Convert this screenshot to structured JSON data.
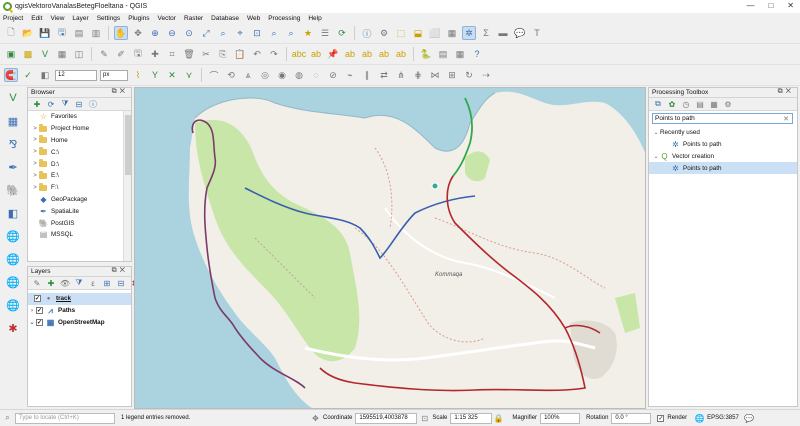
{
  "window": {
    "title": "qgisVektoroVanalasBetegFloeltana - QGIS",
    "buttons": [
      "—",
      "□",
      "✕"
    ]
  },
  "menu": [
    "Project",
    "Edit",
    "View",
    "Layer",
    "Settings",
    "Plugins",
    "Vector",
    "Raster",
    "Database",
    "Web",
    "Processing",
    "Help"
  ],
  "toolbar": {
    "snap_tolerance": "12",
    "snap_unit": "px"
  },
  "browser": {
    "title": "Browser",
    "items": [
      {
        "label": "Favorites",
        "icon": "star-icon",
        "expand": ""
      },
      {
        "label": "Project Home",
        "icon": "folder-icon",
        "expand": ">"
      },
      {
        "label": "Home",
        "icon": "folder-icon",
        "expand": ">"
      },
      {
        "label": "C:\\",
        "icon": "folder-icon",
        "expand": ">"
      },
      {
        "label": "D:\\",
        "icon": "folder-icon",
        "expand": ">"
      },
      {
        "label": "E:\\",
        "icon": "folder-icon",
        "expand": ">"
      },
      {
        "label": "F:\\",
        "icon": "folder-icon",
        "expand": ">"
      },
      {
        "label": "GeoPackage",
        "icon": "geopackage-icon",
        "expand": ""
      },
      {
        "label": "SpatiaLite",
        "icon": "spatialite-icon",
        "expand": ""
      },
      {
        "label": "PostGIS",
        "icon": "postgis-icon",
        "expand": ""
      },
      {
        "label": "MSSQL",
        "icon": "mssql-icon",
        "expand": ""
      }
    ]
  },
  "layers": {
    "title": "Layers",
    "items": [
      {
        "label": "track",
        "checked": true,
        "icon": "point-layer-icon",
        "bold": true,
        "selected": true
      },
      {
        "label": "Paths",
        "checked": true,
        "icon": "line-layer-icon",
        "bold": true,
        "selected": false
      },
      {
        "label": "OpenStreetMap",
        "checked": true,
        "icon": "raster-layer-icon",
        "bold": true,
        "selected": false
      }
    ]
  },
  "processing": {
    "title": "Processing Toolbox",
    "search_value": "Points to path",
    "groups": [
      {
        "label": "Recently used",
        "items": [
          "Points to path"
        ]
      },
      {
        "label": "Vector creation",
        "items": [
          "Points to path"
        ]
      }
    ]
  },
  "map": {
    "place_label": "Kommaqa",
    "sea_color": "#aad3df",
    "land_color": "#f2efe9",
    "park_color": "#c8e6a8"
  },
  "status": {
    "locate_placeholder": "Type to locate (Ctrl+K)",
    "message": "1 legend entries removed.",
    "coordinate_label": "Coordinate",
    "coordinate_value": "1595519,4003878",
    "scale_label": "Scale",
    "scale_value": "1:15 325",
    "magnifier_label": "Magnifier",
    "magnifier_value": "100%",
    "rotation_label": "Rotation",
    "rotation_value": "0.0 °",
    "render_label": "Render",
    "crs": "EPSG:3857"
  }
}
